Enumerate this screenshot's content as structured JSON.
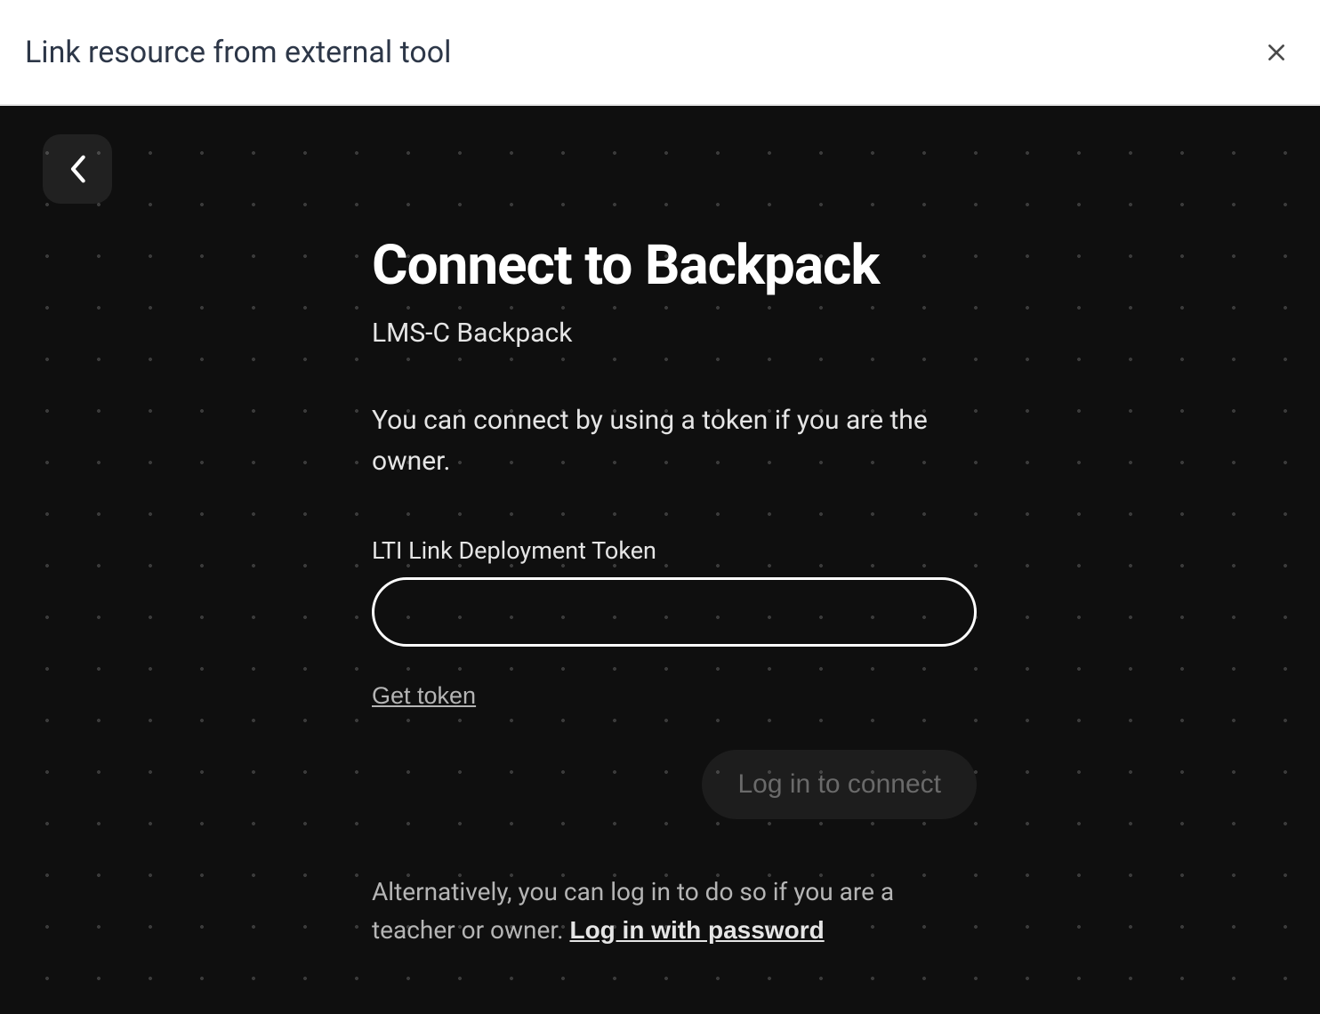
{
  "header": {
    "title": "Link resource from external tool"
  },
  "content": {
    "main_title": "Connect to Backpack",
    "subtitle": "LMS-C Backpack",
    "description": "You can connect by using a token if you are the owner.",
    "field_label": "LTI Link Deployment Token",
    "token_value": "",
    "get_token_label": "Get token",
    "login_button_label": "Log in to connect",
    "alt_text": "Alternatively, you can log in to do so if you are a teacher or owner. ",
    "password_link_label": "Log in with password"
  }
}
